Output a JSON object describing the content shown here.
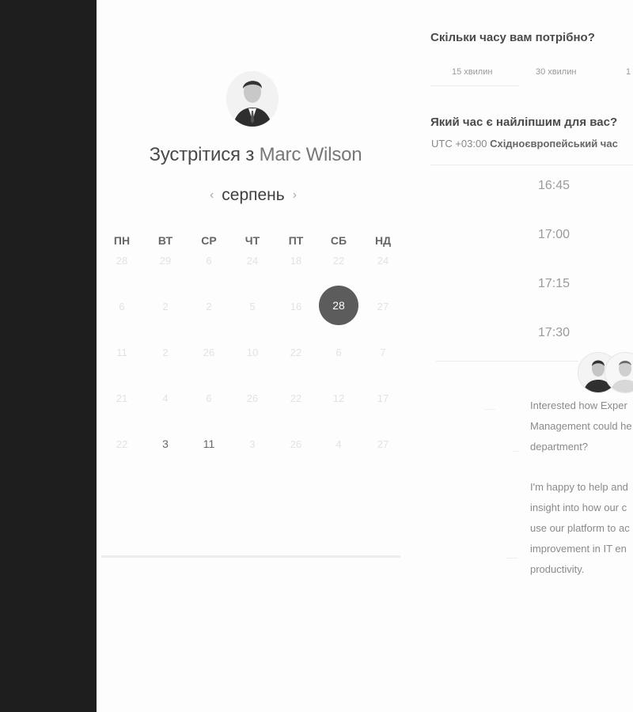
{
  "booking": {
    "title_prefix": "Зустрітися з",
    "host_name": "Marc Wilson",
    "month": "серпень",
    "prev_icon": "chevron-left-icon",
    "next_icon": "chevron-right-icon",
    "weekdays": [
      "ПН",
      "ВТ",
      "СР",
      "ЧТ",
      "ПТ",
      "СБ",
      "НД"
    ],
    "weeks": [
      [
        "28",
        "29",
        "6",
        "24",
        "18",
        "22",
        "24"
      ],
      [
        "6",
        "2",
        "2",
        "5",
        "16",
        "28",
        "27"
      ],
      [
        "11",
        "2",
        "26",
        "10",
        "22",
        "6",
        "7"
      ],
      [
        "21",
        "4",
        "6",
        "26",
        "22",
        "12",
        "17"
      ],
      [
        "22",
        "3",
        "11",
        "3",
        "26",
        "4",
        "27"
      ]
    ],
    "selected_day": "28"
  },
  "duration": {
    "question": "Скільки часу вам потрібно?",
    "options": [
      "15 хвилин",
      "30 хвилин",
      "1"
    ]
  },
  "time": {
    "question": "Який час є найліпшим для вас?",
    "timezone_offset": "UTC +03:00",
    "timezone_name": "Східноєвропейський час",
    "slots": [
      "16:45",
      "17:00",
      "17:15",
      "17:30"
    ]
  },
  "description": {
    "para1_lines": [
      "Interested how Exper",
      "Management could he",
      "department?"
    ],
    "para2_lines": [
      "I'm happy to help and",
      "insight into how our c",
      "use our platform to ac",
      "improvement in IT en",
      "productivity."
    ]
  }
}
